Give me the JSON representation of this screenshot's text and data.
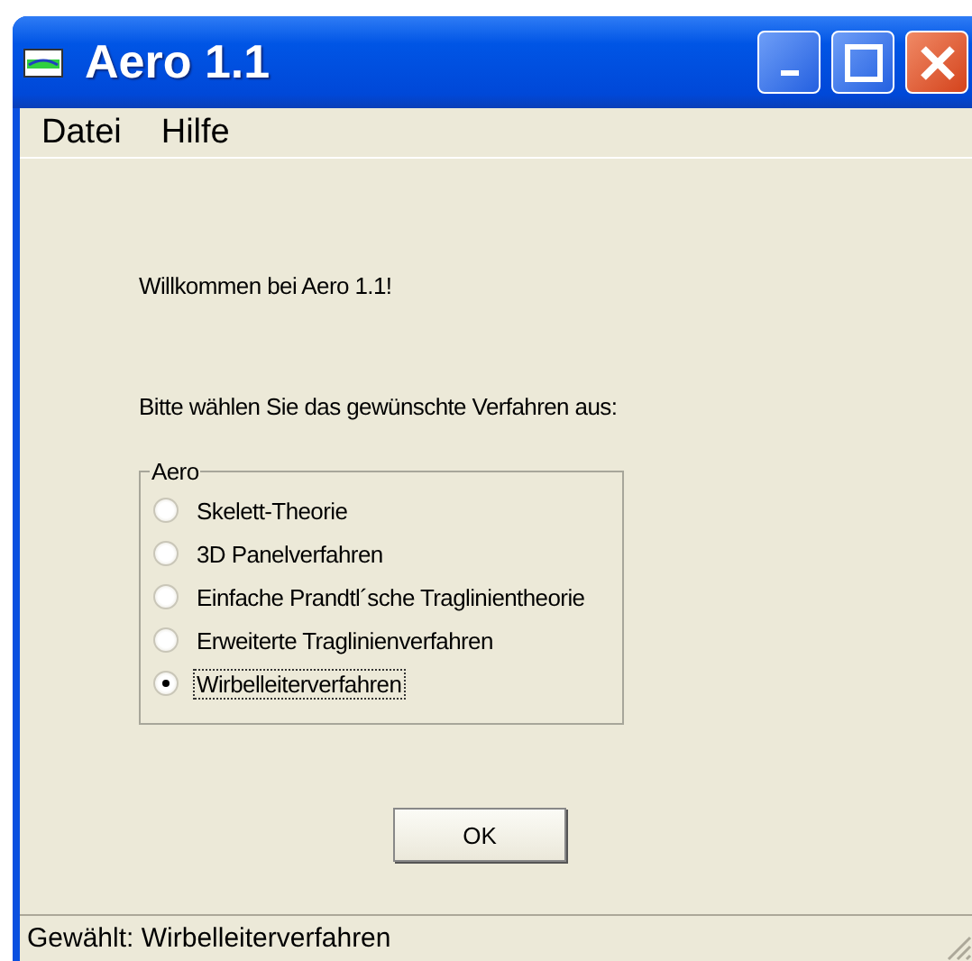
{
  "window": {
    "title": "Aero 1.1"
  },
  "menu": [
    "Datei",
    "Hilfe"
  ],
  "welcome": "Willkommen bei Aero 1.1!",
  "prompt": "Bitte wählen Sie das gewünschte Verfahren aus:",
  "group": {
    "title": "Aero",
    "options": [
      {
        "label": "Skelett-Theorie",
        "selected": false
      },
      {
        "label": "3D Panelverfahren",
        "selected": false
      },
      {
        "label": "Einfache Prandtl´sche Traglinientheorie",
        "selected": false
      },
      {
        "label": "Erweiterte Traglinienverfahren",
        "selected": false
      },
      {
        "label": "Wirbelleiterverfahren",
        "selected": true
      }
    ]
  },
  "buttons": [
    "OK"
  ],
  "status_bar": "Gewählt: Wirbelleiterverfahren"
}
